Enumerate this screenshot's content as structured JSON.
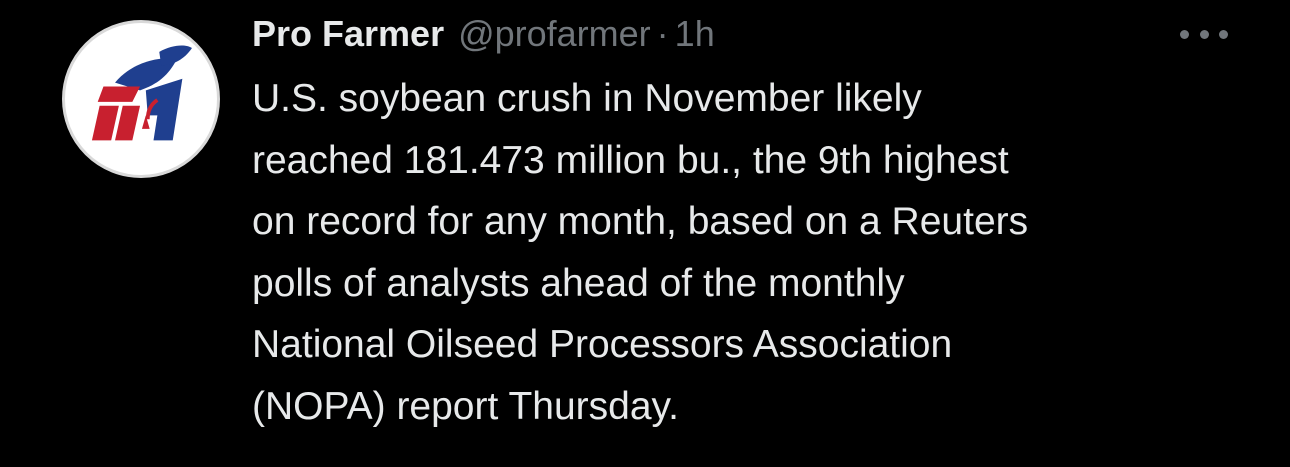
{
  "tweet": {
    "author_name": "Pro Farmer",
    "handle": "@profarmer",
    "separator": "·",
    "time": "1h",
    "more_icon": "more-horizontal-icon",
    "avatar_icon": "pro-farmer-logo",
    "text_lines": [
      "U.S. soybean crush in November likely",
      "reached 181.473 million bu., the 9th highest",
      "on record for any month, based on a Reuters",
      "polls of analysts ahead of the monthly",
      "National Oilseed Processors Association",
      "(NOPA) report Thursday."
    ]
  },
  "colors": {
    "background": "#000000",
    "primary_text": "#e7e9ea",
    "secondary_text": "#71767b",
    "logo_red": "#c8202f",
    "logo_blue": "#1f3f8f"
  }
}
